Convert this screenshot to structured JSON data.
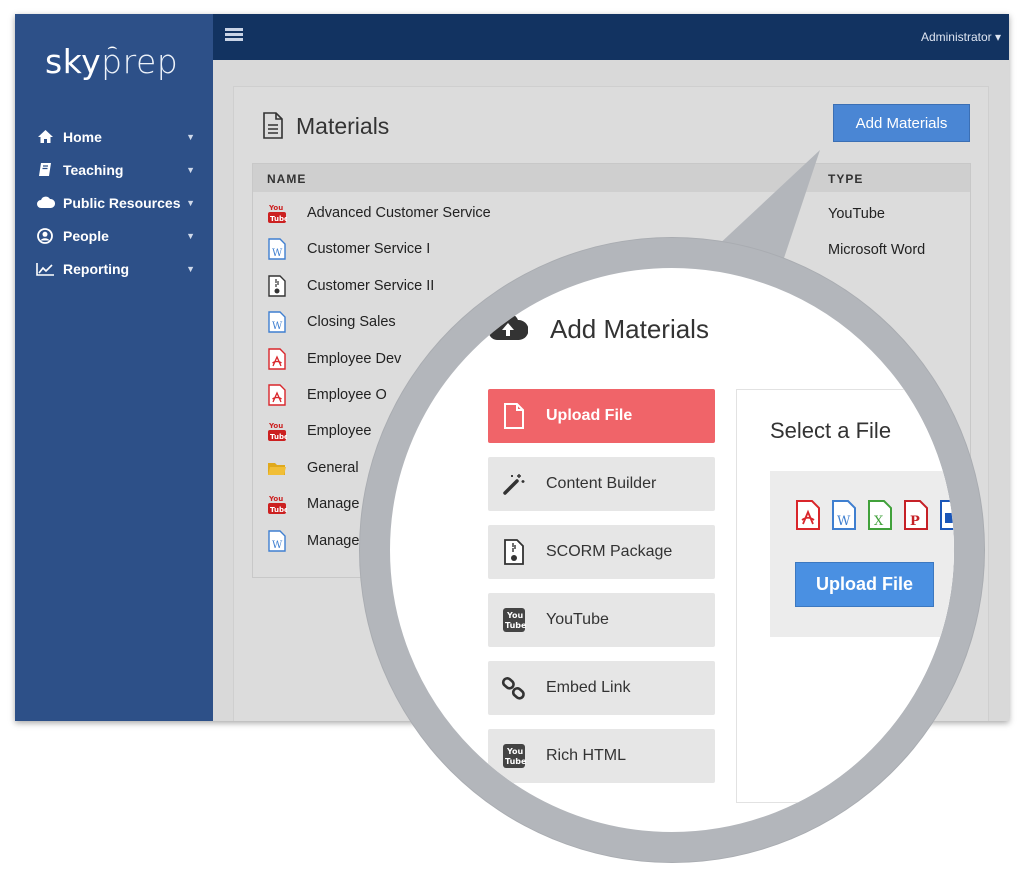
{
  "brand": {
    "sky": "sky",
    "prep": "prep"
  },
  "topbar": {
    "user_label": "Administrator ▾"
  },
  "sidebar": {
    "items": [
      {
        "label": "Home",
        "icon": "home-icon"
      },
      {
        "label": "Teaching",
        "icon": "book-icon"
      },
      {
        "label": "Public Resources",
        "icon": "cloud-icon"
      },
      {
        "label": "People",
        "icon": "user-circle-icon"
      },
      {
        "label": "Reporting",
        "icon": "line-chart-icon"
      }
    ]
  },
  "materials": {
    "title": "Materials",
    "add_button": "Add Materials",
    "columns": {
      "name": "NAME",
      "type": "TYPE"
    },
    "rows": [
      {
        "name": "Advanced Customer Service",
        "type": "YouTube",
        "icon": "youtube-icon"
      },
      {
        "name": "Customer Service I",
        "type": "Microsoft Word",
        "icon": "word-file-icon"
      },
      {
        "name": "Customer Service II",
        "type": "",
        "icon": "zip-file-icon"
      },
      {
        "name": "Closing Sales",
        "type": "",
        "icon": "word-file-icon"
      },
      {
        "name": "Employee Dev",
        "type": "",
        "icon": "pdf-file-icon"
      },
      {
        "name": "Employee O",
        "type": "",
        "icon": "pdf-file-icon"
      },
      {
        "name": "Employee",
        "type": "",
        "icon": "youtube-icon"
      },
      {
        "name": "General",
        "type": "",
        "icon": "folder-icon"
      },
      {
        "name": "Manage",
        "type": "",
        "icon": "youtube-icon"
      },
      {
        "name": "Manage",
        "type": "",
        "icon": "word-file-icon"
      }
    ]
  },
  "modal": {
    "title": "Add Materials",
    "options": [
      {
        "label": "Upload File",
        "icon": "file-icon",
        "active": true
      },
      {
        "label": "Content Builder",
        "icon": "magic-wand-icon",
        "active": false
      },
      {
        "label": "SCORM Package",
        "icon": "zip-file-icon",
        "active": false
      },
      {
        "label": "YouTube",
        "icon": "youtube-icon",
        "active": false
      },
      {
        "label": "Embed Link",
        "icon": "link-icon",
        "active": false
      },
      {
        "label": "Rich HTML",
        "icon": "youtube-icon",
        "active": false
      }
    ],
    "select_title": "Select a File",
    "upload_button": "Upload File",
    "file_types": [
      "pdf-icon",
      "word-icon",
      "excel-icon",
      "powerpoint-icon",
      "video-icon"
    ]
  },
  "colors": {
    "sidebar": "#2d5088",
    "topbar": "#123361",
    "primary_button": "#4a86d4",
    "active_option": "#f06469",
    "magnifier_ring": "#b3b6bb"
  }
}
